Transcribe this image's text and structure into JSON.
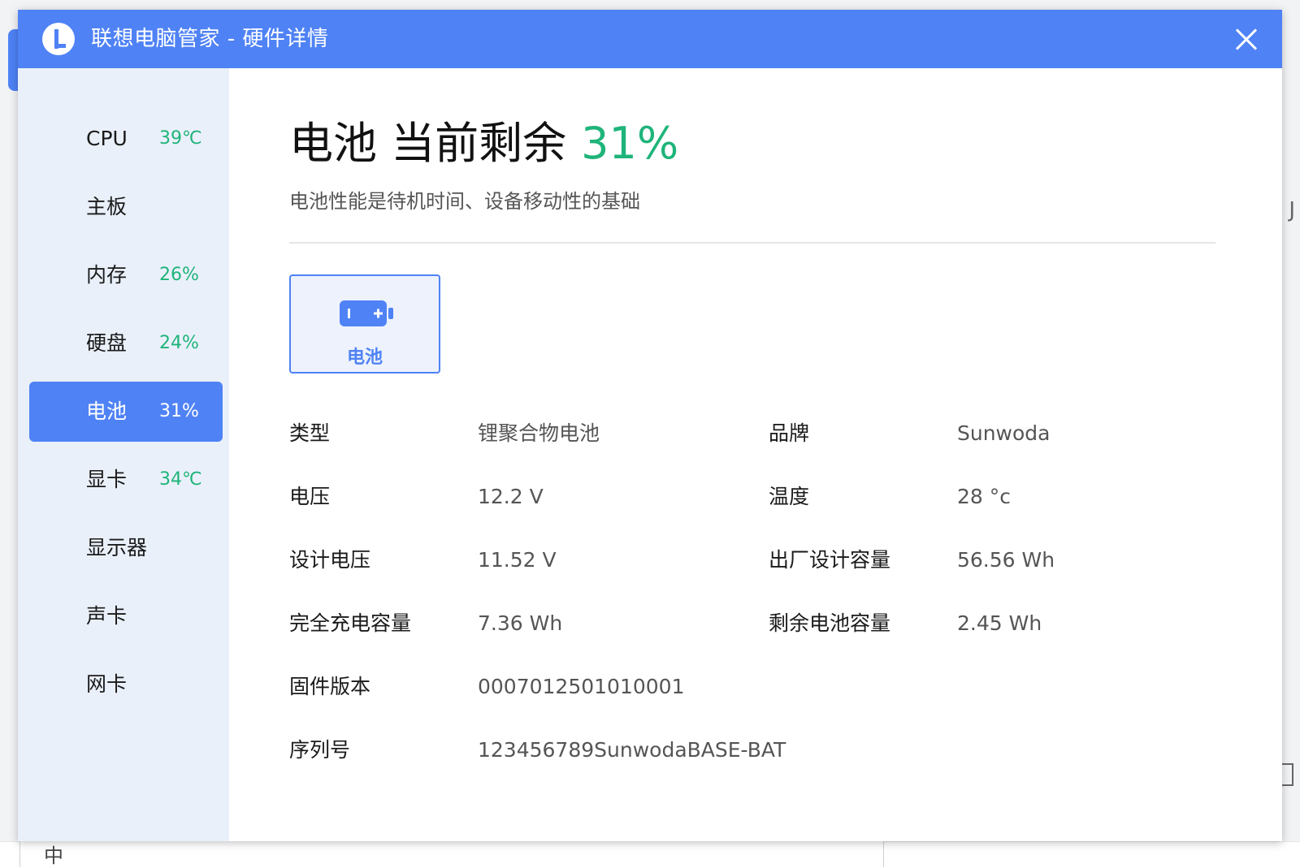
{
  "window": {
    "title": "联想电脑管家 - 硬件详情"
  },
  "sidebar": {
    "items": [
      {
        "label": "CPU",
        "value": "39℃"
      },
      {
        "label": "主板",
        "value": ""
      },
      {
        "label": "内存",
        "value": "26%"
      },
      {
        "label": "硬盘",
        "value": "24%"
      },
      {
        "label": "电池",
        "value": "31%",
        "active": true
      },
      {
        "label": "显卡",
        "value": "34℃"
      },
      {
        "label": "显示器",
        "value": ""
      },
      {
        "label": "声卡",
        "value": ""
      },
      {
        "label": "网卡",
        "value": ""
      }
    ]
  },
  "main": {
    "headline": "电池 当前剩余",
    "headline_pct": "31%",
    "subtitle": "电池性能是待机时间、设备移动性的基础",
    "device_tab_label": "电池",
    "specs": [
      {
        "label": "类型",
        "value": "锂聚合物电池"
      },
      {
        "label": "品牌",
        "value": "Sunwoda"
      },
      {
        "label": "电压",
        "value": "12.2 V"
      },
      {
        "label": "温度",
        "value": "28 °c"
      },
      {
        "label": "设计电压",
        "value": "11.52 V"
      },
      {
        "label": "出厂设计容量",
        "value": "56.56 Wh"
      },
      {
        "label": "完全充电容量",
        "value": "7.36 Wh"
      },
      {
        "label": "剩余电池容量",
        "value": "2.45 Wh"
      },
      {
        "label": "固件版本",
        "value": "0007012501010001"
      },
      {
        "label": "序列号",
        "value": "123456789SunwodaBASE-BAT"
      }
    ]
  },
  "background": {
    "bottom_text": "中"
  },
  "colors": {
    "accent": "#4f82f5",
    "good": "#1fb47a",
    "sidebar_bg": "#eaf0fa"
  }
}
